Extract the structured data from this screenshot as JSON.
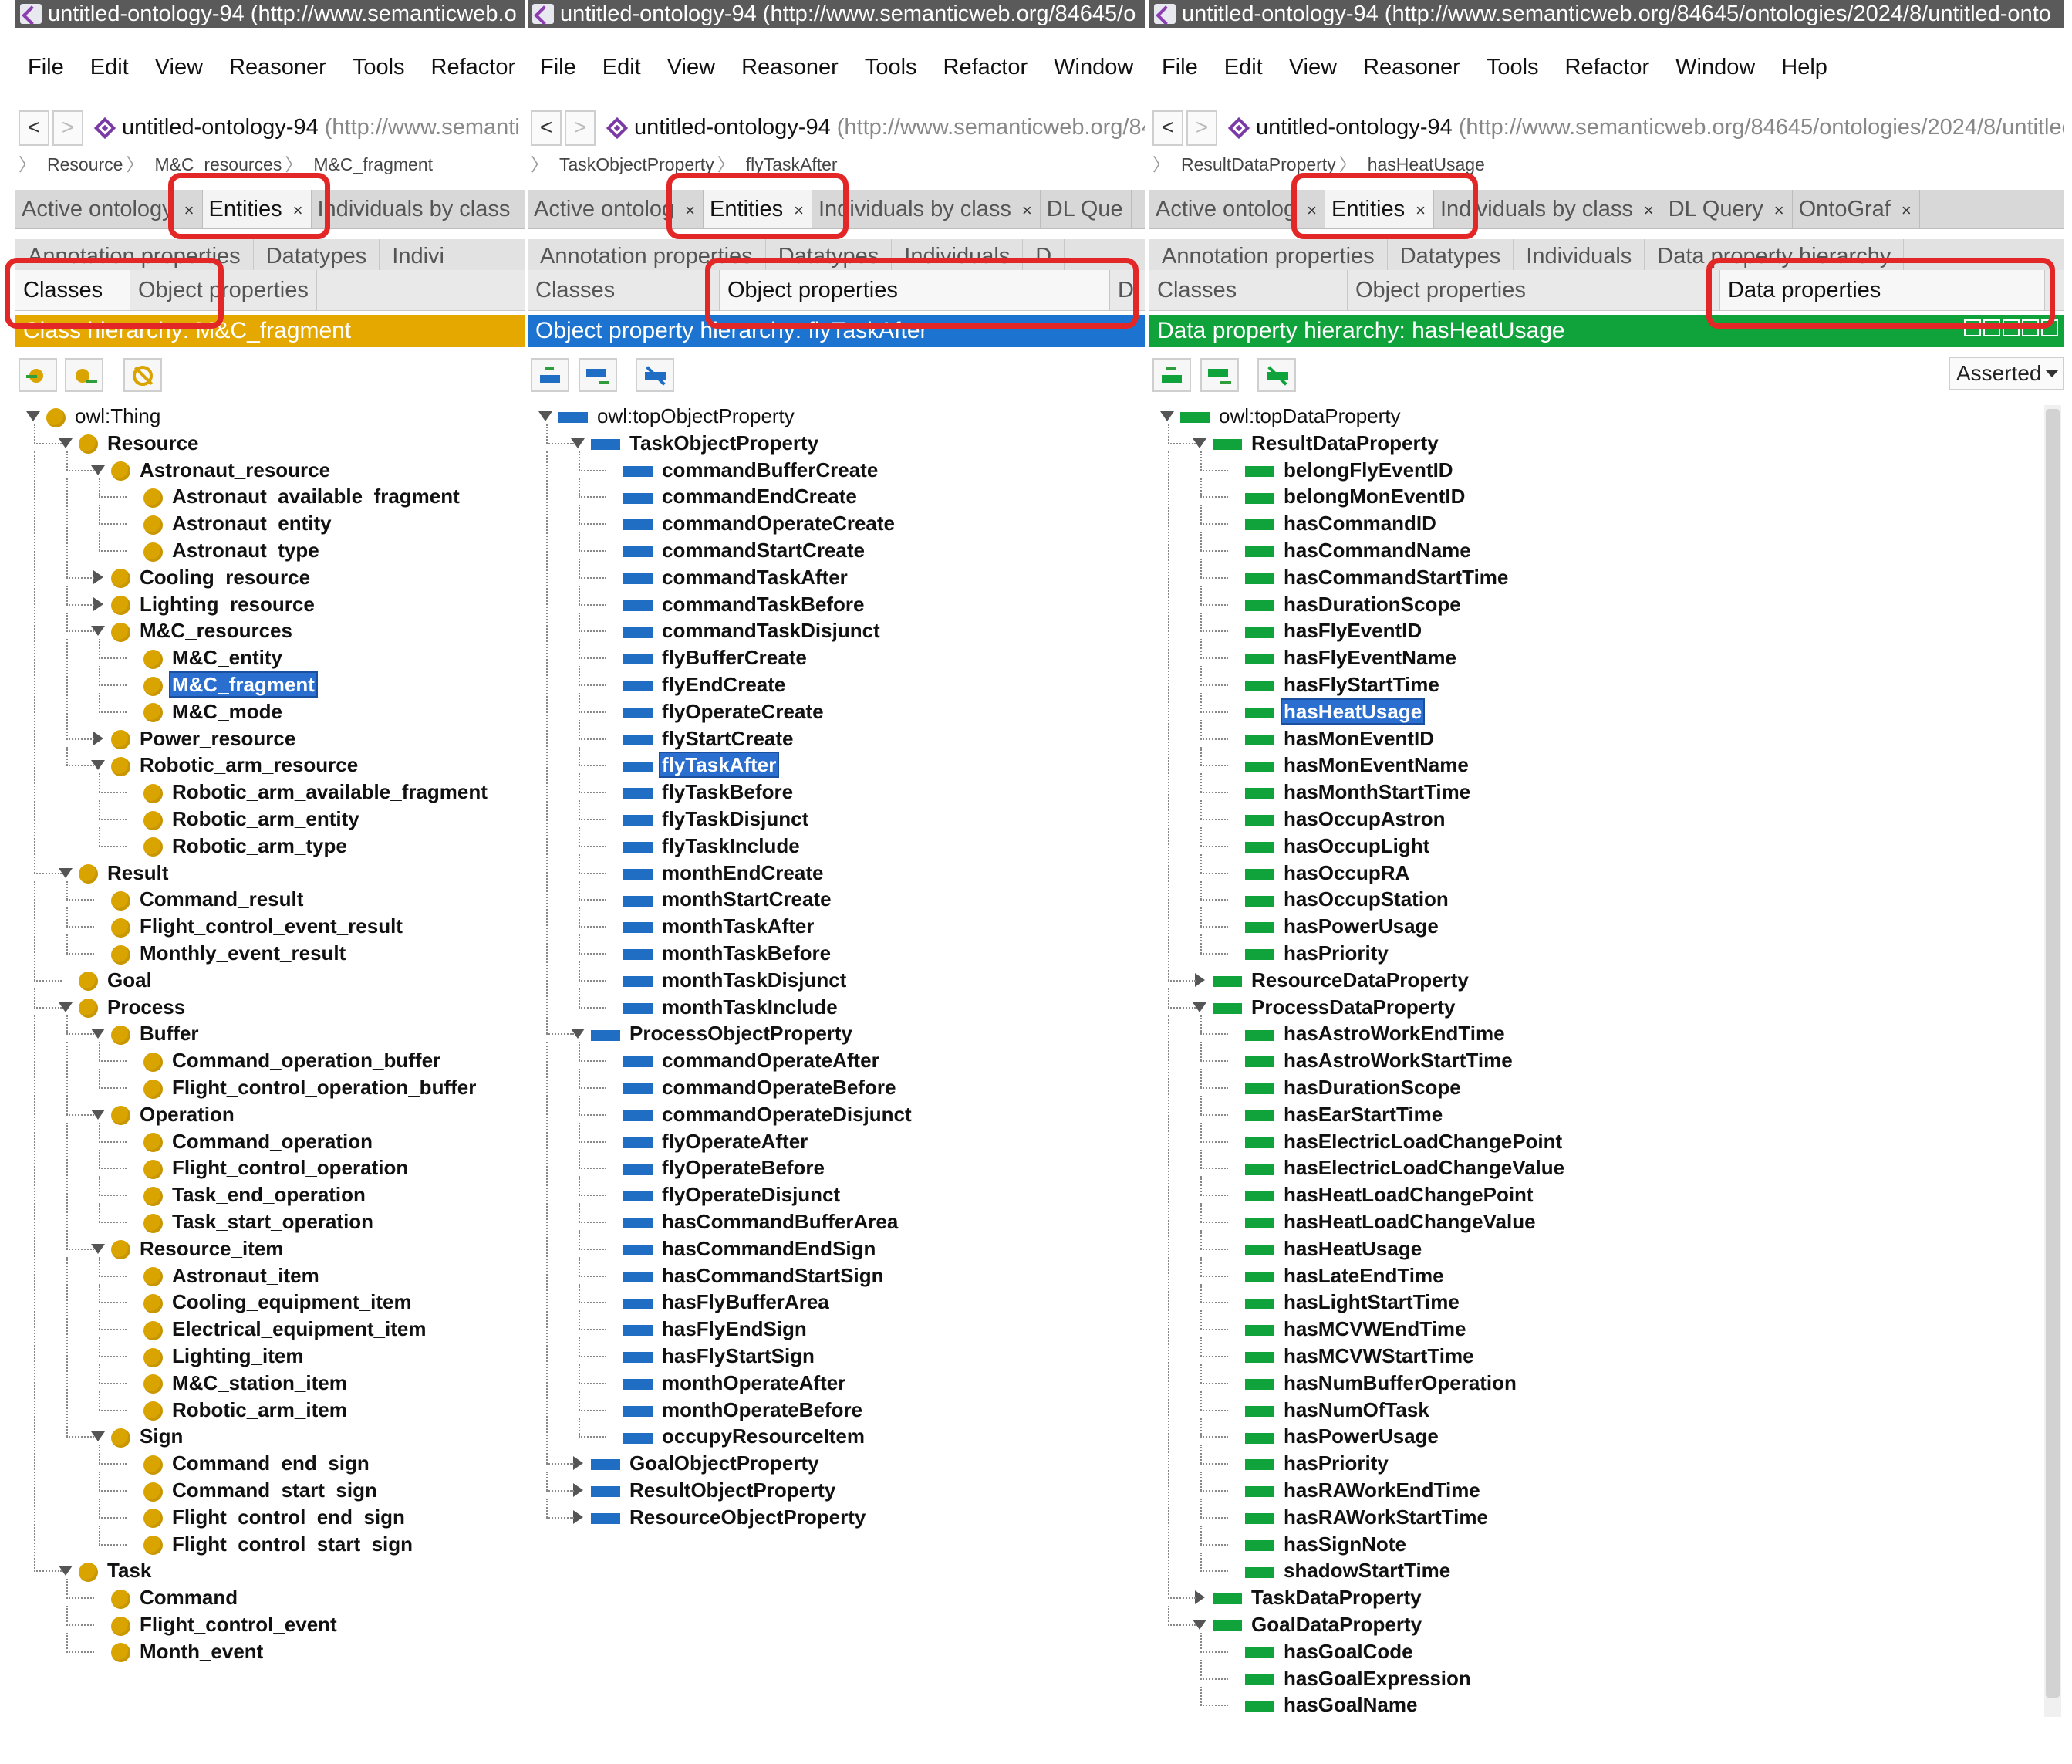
{
  "colors": {
    "class_header": "#e5a800",
    "object_header": "#1d74d0",
    "data_header": "#11a33b",
    "class_icon": "#d9a300",
    "object_icon": "#1f6ec4",
    "data_icon": "#11a33b",
    "selection": "#2a6fcf",
    "highlight_box": "#e32626"
  },
  "panels": [
    {
      "window_title": "untitled-ontology-94 (http://www.semanticweb.o",
      "menu": [
        "File",
        "Edit",
        "View",
        "Reasoner",
        "Tools",
        "Refactor"
      ],
      "address": {
        "name": "untitled-ontology-94",
        "iri": "(http://www.semanti"
      },
      "breadcrumb": [
        "Resource",
        "M&C_resources",
        "M&C_fragment"
      ],
      "tabs": [
        {
          "label": "Active ontology",
          "close": "×"
        },
        {
          "label": "Entities",
          "close": "×"
        },
        {
          "label": "Individuals by class",
          "close": ""
        }
      ],
      "subtabs_row1": [
        "Annotation properties",
        "Datatypes",
        "Indivi"
      ],
      "subtabs_row2": [
        "Classes",
        "Object properties"
      ],
      "hierarchy_title": "Class hierarchy: M&C_fragment",
      "tree": [
        {
          "label": "owl:Thing",
          "d": 0,
          "t": "open",
          "plain": true
        },
        {
          "label": "Resource",
          "d": 1,
          "t": "open"
        },
        {
          "label": "Astronaut_resource",
          "d": 2,
          "t": "open"
        },
        {
          "label": "Astronaut_available_fragment",
          "d": 3
        },
        {
          "label": "Astronaut_entity",
          "d": 3
        },
        {
          "label": "Astronaut_type",
          "d": 3
        },
        {
          "label": "Cooling_resource",
          "d": 2,
          "t": "closed"
        },
        {
          "label": "Lighting_resource",
          "d": 2,
          "t": "closed"
        },
        {
          "label": "M&C_resources",
          "d": 2,
          "t": "open"
        },
        {
          "label": "M&C_entity",
          "d": 3
        },
        {
          "label": "M&C_fragment",
          "d": 3,
          "sel": true
        },
        {
          "label": "M&C_mode",
          "d": 3
        },
        {
          "label": "Power_resource",
          "d": 2,
          "t": "closed"
        },
        {
          "label": "Robotic_arm_resource",
          "d": 2,
          "t": "open"
        },
        {
          "label": "Robotic_arm_available_fragment",
          "d": 3
        },
        {
          "label": "Robotic_arm_entity",
          "d": 3
        },
        {
          "label": "Robotic_arm_type",
          "d": 3
        },
        {
          "label": "Result",
          "d": 1,
          "t": "open"
        },
        {
          "label": "Command_result",
          "d": 2
        },
        {
          "label": "Flight_control_event_result",
          "d": 2
        },
        {
          "label": "Monthly_event_result",
          "d": 2
        },
        {
          "label": "Goal",
          "d": 1
        },
        {
          "label": "Process",
          "d": 1,
          "t": "open"
        },
        {
          "label": "Buffer",
          "d": 2,
          "t": "open"
        },
        {
          "label": "Command_operation_buffer",
          "d": 3
        },
        {
          "label": "Flight_control_operation_buffer",
          "d": 3
        },
        {
          "label": "Operation",
          "d": 2,
          "t": "open"
        },
        {
          "label": "Command_operation",
          "d": 3
        },
        {
          "label": "Flight_control_operation",
          "d": 3
        },
        {
          "label": "Task_end_operation",
          "d": 3
        },
        {
          "label": "Task_start_operation",
          "d": 3
        },
        {
          "label": "Resource_item",
          "d": 2,
          "t": "open"
        },
        {
          "label": "Astronaut_item",
          "d": 3
        },
        {
          "label": "Cooling_equipment_item",
          "d": 3
        },
        {
          "label": "Electrical_equipment_item",
          "d": 3
        },
        {
          "label": "Lighting_item",
          "d": 3
        },
        {
          "label": "M&C_station_item",
          "d": 3
        },
        {
          "label": "Robotic_arm_item",
          "d": 3
        },
        {
          "label": "Sign",
          "d": 2,
          "t": "open"
        },
        {
          "label": "Command_end_sign",
          "d": 3
        },
        {
          "label": "Command_start_sign",
          "d": 3
        },
        {
          "label": "Flight_control_end_sign",
          "d": 3
        },
        {
          "label": "Flight_control_start_sign",
          "d": 3
        },
        {
          "label": "Task",
          "d": 1,
          "t": "open"
        },
        {
          "label": "Command",
          "d": 2
        },
        {
          "label": "Flight_control_event",
          "d": 2
        },
        {
          "label": "Month_event",
          "d": 2
        }
      ]
    },
    {
      "window_title": "untitled-ontology-94 (http://www.semanticweb.org/84645/o",
      "menu": [
        "File",
        "Edit",
        "View",
        "Reasoner",
        "Tools",
        "Refactor",
        "Window"
      ],
      "address": {
        "name": "untitled-ontology-94",
        "iri": "(http://www.semanticweb.org/84"
      },
      "breadcrumb": [
        "TaskObjectProperty",
        "flyTaskAfter"
      ],
      "tabs": [
        {
          "label": "Active ontolog",
          "close": "×"
        },
        {
          "label": "Entities",
          "close": "×"
        },
        {
          "label": "Individuals by class",
          "close": "×"
        },
        {
          "label": "DL Que",
          "close": ""
        }
      ],
      "subtabs_row1": [
        "Annotation properties",
        "Datatypes",
        "Individuals",
        "D"
      ],
      "subtabs_row2": [
        "Classes",
        "Object properties",
        "D"
      ],
      "hierarchy_title": "Object property hierarchy: flyTaskAfter",
      "tree": [
        {
          "label": "owl:topObjectProperty",
          "d": 0,
          "t": "open",
          "plain": true
        },
        {
          "label": "TaskObjectProperty",
          "d": 1,
          "t": "open"
        },
        {
          "label": "commandBufferCreate",
          "d": 2
        },
        {
          "label": "commandEndCreate",
          "d": 2
        },
        {
          "label": "commandOperateCreate",
          "d": 2
        },
        {
          "label": "commandStartCreate",
          "d": 2
        },
        {
          "label": "commandTaskAfter",
          "d": 2
        },
        {
          "label": "commandTaskBefore",
          "d": 2
        },
        {
          "label": "commandTaskDisjunct",
          "d": 2
        },
        {
          "label": "flyBufferCreate",
          "d": 2
        },
        {
          "label": "flyEndCreate",
          "d": 2
        },
        {
          "label": "flyOperateCreate",
          "d": 2
        },
        {
          "label": "flyStartCreate",
          "d": 2
        },
        {
          "label": "flyTaskAfter",
          "d": 2,
          "sel": true
        },
        {
          "label": "flyTaskBefore",
          "d": 2
        },
        {
          "label": "flyTaskDisjunct",
          "d": 2
        },
        {
          "label": "flyTaskInclude",
          "d": 2
        },
        {
          "label": "monthEndCreate",
          "d": 2
        },
        {
          "label": "monthStartCreate",
          "d": 2
        },
        {
          "label": "monthTaskAfter",
          "d": 2
        },
        {
          "label": "monthTaskBefore",
          "d": 2
        },
        {
          "label": "monthTaskDisjunct",
          "d": 2
        },
        {
          "label": "monthTaskInclude",
          "d": 2
        },
        {
          "label": "ProcessObjectProperty",
          "d": 1,
          "t": "open"
        },
        {
          "label": "commandOperateAfter",
          "d": 2
        },
        {
          "label": "commandOperateBefore",
          "d": 2
        },
        {
          "label": "commandOperateDisjunct",
          "d": 2
        },
        {
          "label": "flyOperateAfter",
          "d": 2
        },
        {
          "label": "flyOperateBefore",
          "d": 2
        },
        {
          "label": "flyOperateDisjunct",
          "d": 2
        },
        {
          "label": "hasCommandBufferArea",
          "d": 2
        },
        {
          "label": "hasCommandEndSign",
          "d": 2
        },
        {
          "label": "hasCommandStartSign",
          "d": 2
        },
        {
          "label": "hasFlyBufferArea",
          "d": 2
        },
        {
          "label": "hasFlyEndSign",
          "d": 2
        },
        {
          "label": "hasFlyStartSign",
          "d": 2
        },
        {
          "label": "monthOperateAfter",
          "d": 2
        },
        {
          "label": "monthOperateBefore",
          "d": 2
        },
        {
          "label": "occupyResourceItem",
          "d": 2
        },
        {
          "label": "GoalObjectProperty",
          "d": 1,
          "t": "closed"
        },
        {
          "label": "ResultObjectProperty",
          "d": 1,
          "t": "closed"
        },
        {
          "label": "ResourceObjectProperty",
          "d": 1,
          "t": "closed"
        }
      ]
    },
    {
      "window_title": "untitled-ontology-94 (http://www.semanticweb.org/84645/ontologies/2024/8/untitled-onto",
      "menu": [
        "File",
        "Edit",
        "View",
        "Reasoner",
        "Tools",
        "Refactor",
        "Window",
        "Help"
      ],
      "address": {
        "name": "untitled-ontology-94",
        "iri": "(http://www.semanticweb.org/84645/ontologies/2024/8/untitled-"
      },
      "breadcrumb": [
        "ResultDataProperty",
        "hasHeatUsage"
      ],
      "tabs": [
        {
          "label": "Active ontolog",
          "close": "×"
        },
        {
          "label": "Entities",
          "close": "×"
        },
        {
          "label": "Individuals by class",
          "close": "×"
        },
        {
          "label": "DL Query",
          "close": "×"
        },
        {
          "label": "OntoGraf",
          "close": "×"
        }
      ],
      "subtabs_row1": [
        "Annotation properties",
        "Datatypes",
        "Individuals",
        "Data property hierarchy"
      ],
      "subtabs_row2": [
        "Classes",
        "Object properties",
        "Data properties"
      ],
      "hierarchy_title": "Data property hierarchy: hasHeatUsage",
      "asserted": "Asserted",
      "tree": [
        {
          "label": "owl:topDataProperty",
          "d": 0,
          "t": "open",
          "plain": true
        },
        {
          "label": "ResultDataProperty",
          "d": 1,
          "t": "open"
        },
        {
          "label": "belongFlyEventID",
          "d": 2
        },
        {
          "label": "belongMonEventID",
          "d": 2
        },
        {
          "label": "hasCommandID",
          "d": 2
        },
        {
          "label": "hasCommandName",
          "d": 2
        },
        {
          "label": "hasCommandStartTime",
          "d": 2
        },
        {
          "label": "hasDurationScope",
          "d": 2
        },
        {
          "label": "hasFlyEventID",
          "d": 2
        },
        {
          "label": "hasFlyEventName",
          "d": 2
        },
        {
          "label": "hasFlyStartTime",
          "d": 2
        },
        {
          "label": "hasHeatUsage",
          "d": 2,
          "sel": true
        },
        {
          "label": "hasMonEventID",
          "d": 2
        },
        {
          "label": "hasMonEventName",
          "d": 2
        },
        {
          "label": "hasMonthStartTime",
          "d": 2
        },
        {
          "label": "hasOccupAstron",
          "d": 2
        },
        {
          "label": "hasOccupLight",
          "d": 2
        },
        {
          "label": "hasOccupRA",
          "d": 2
        },
        {
          "label": "hasOccupStation",
          "d": 2
        },
        {
          "label": "hasPowerUsage",
          "d": 2
        },
        {
          "label": "hasPriority",
          "d": 2
        },
        {
          "label": "ResourceDataProperty",
          "d": 1,
          "t": "closed"
        },
        {
          "label": "ProcessDataProperty",
          "d": 1,
          "t": "open"
        },
        {
          "label": "hasAstroWorkEndTime",
          "d": 2
        },
        {
          "label": "hasAstroWorkStartTime",
          "d": 2
        },
        {
          "label": "hasDurationScope",
          "d": 2
        },
        {
          "label": "hasEarStartTime",
          "d": 2
        },
        {
          "label": "hasElectricLoadChangePoint",
          "d": 2
        },
        {
          "label": "hasElectricLoadChangeValue",
          "d": 2
        },
        {
          "label": "hasHeatLoadChangePoint",
          "d": 2
        },
        {
          "label": "hasHeatLoadChangeValue",
          "d": 2
        },
        {
          "label": "hasHeatUsage",
          "d": 2
        },
        {
          "label": "hasLateEndTime",
          "d": 2
        },
        {
          "label": "hasLightStartTime",
          "d": 2
        },
        {
          "label": "hasMCVWEndTime",
          "d": 2
        },
        {
          "label": "hasMCVWStartTime",
          "d": 2
        },
        {
          "label": "hasNumBufferOperation",
          "d": 2
        },
        {
          "label": "hasNumOfTask",
          "d": 2
        },
        {
          "label": "hasPowerUsage",
          "d": 2
        },
        {
          "label": "hasPriority",
          "d": 2
        },
        {
          "label": "hasRAWorkEndTime",
          "d": 2
        },
        {
          "label": "hasRAWorkStartTime",
          "d": 2
        },
        {
          "label": "hasSignNote",
          "d": 2
        },
        {
          "label": "shadowStartTime",
          "d": 2
        },
        {
          "label": "TaskDataProperty",
          "d": 1,
          "t": "closed"
        },
        {
          "label": "GoalDataProperty",
          "d": 1,
          "t": "open"
        },
        {
          "label": "hasGoalCode",
          "d": 2
        },
        {
          "label": "hasGoalExpression",
          "d": 2
        },
        {
          "label": "hasGoalName",
          "d": 2
        }
      ]
    }
  ]
}
